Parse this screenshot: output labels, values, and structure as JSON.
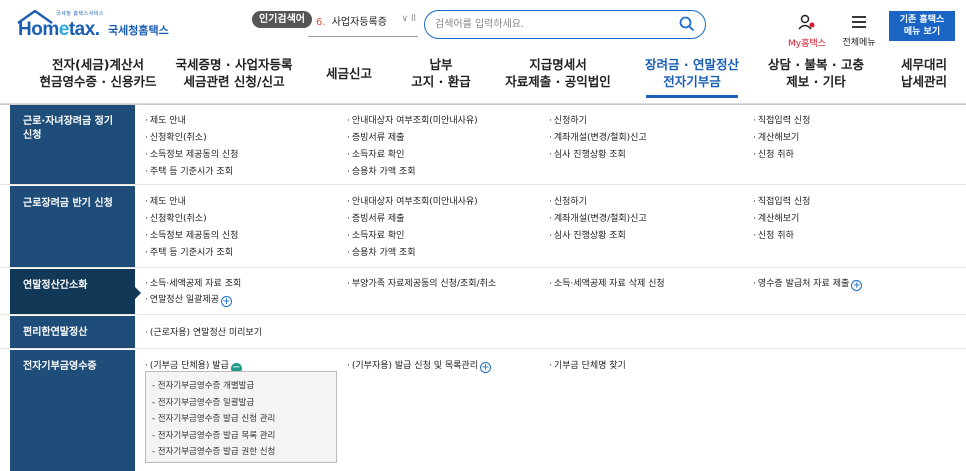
{
  "header": {
    "logo_tiny": "국세청 홈택스서비스",
    "logo_word_pre": "Hom",
    "logo_word_e": "e",
    "logo_word_post": "tax.",
    "logo_kor": "국세청홈택스",
    "popular_badge": "인기검색어",
    "popular_num": "6.",
    "popular_text": "사업자등록증",
    "popular_ctrl": "∨ ll",
    "search_placeholder": "검색어를 입력하세요.",
    "my_hometax": "My홈택스",
    "all_menu": "전체메뉴",
    "old_hometax": "기존 홈택스\n메뉴 보기"
  },
  "gnb": [
    {
      "line1": "전자(세금)계산서",
      "line2": "현금영수증 · 신용카드"
    },
    {
      "line1": "국세증명 · 사업자등록",
      "line2": "세금관련 신청/신고"
    },
    {
      "line1": "세금신고",
      "line2": ""
    },
    {
      "line1": "납부",
      "line2": "고지 · 환급"
    },
    {
      "line1": "지급명세서",
      "line2": "자료제출 · 공익법인"
    },
    {
      "line1": "장려금 · 연말정산",
      "line2": "전자기부금"
    },
    {
      "line1": "상담 · 불복 · 고충",
      "line2": "제보 · 기타"
    },
    {
      "line1": "세무대리",
      "line2": "납세관리"
    }
  ],
  "rows": [
    {
      "title": "근로·자녀장려금 정기\n신청",
      "links": [
        "제도 안내",
        "안내대상자 여부조회(미안내사유)",
        "신청하기",
        "직접입력 신청",
        "신청확인(취소)",
        "증빙서류 제출",
        "계좌개설(변경/철회)신고",
        "계산해보기",
        "소득정보 제공동의 신청",
        "소득자료 확인",
        "심사 진행상황 조회",
        "신청 취하",
        "주택 등 기준시가 조회",
        "승용차 가액 조회"
      ]
    },
    {
      "title": "근로장려금 반기 신청",
      "links": [
        "제도 안내",
        "안내대상자 여부조회(미안내사유)",
        "신청하기",
        "직접입력 신청",
        "신청확인(취소)",
        "증빙서류 제출",
        "계좌개설(변경/철회)신고",
        "계산해보기",
        "소득정보 제공동의 신청",
        "소득자료 확인",
        "심사 진행상황 조회",
        "신청 취하",
        "주택 등 기준시가 조회",
        "승용차 가액 조회"
      ]
    },
    {
      "title": "연말정산간소화",
      "links": [
        "소득·세액공제 자료 조회",
        "부양가족 자료제공동의 신청/조회/취소",
        "소득·세액공제 자료 삭제 신청",
        "영수증 발급처 자료 제출",
        "연말정산 일괄제공"
      ]
    },
    {
      "title": "편리한연말정산",
      "links": [
        "(근로자용) 연말정산 미리보기"
      ]
    },
    {
      "title": "전자기부금영수증",
      "links": [
        "(기부금 단체용) 발급",
        "(기부자용) 발급 신청 및 목록관리",
        "기부금 단체명 찾기"
      ],
      "sub_items": [
        "전자기부금영수증 개별발급",
        "전자기부금영수증 일괄발급",
        "전자기부금영수증 발급 신청 관리",
        "전자기부금영수증 발급 목록 관리",
        "전자기부금영수증 발급 권한 신청"
      ]
    }
  ]
}
